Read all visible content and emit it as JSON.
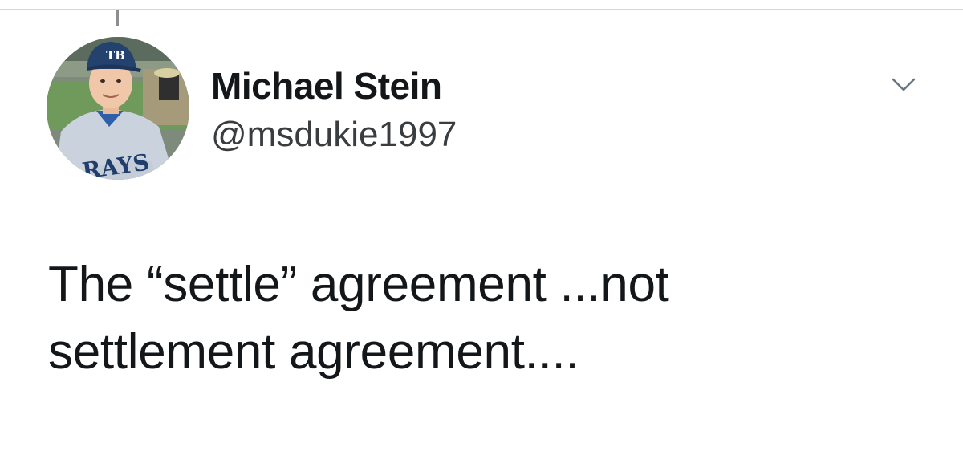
{
  "tweet": {
    "author": {
      "display_name": "Michael Stein",
      "handle": "@msdukie1997",
      "avatar_icon": "profile-photo-rays-fan",
      "avatar_cap_text": "TB",
      "avatar_jersey_text": "RAYS"
    },
    "menu_icon": "chevron-down-icon",
    "text_lines": [
      "The “settle” agreement ...not",
      "settlement agreement...."
    ]
  },
  "colors": {
    "text_primary": "#14171a",
    "text_secondary": "#3a3d40",
    "divider": "#d7d7d9",
    "thread_line": "#8a8d91",
    "icon": "#657786"
  }
}
